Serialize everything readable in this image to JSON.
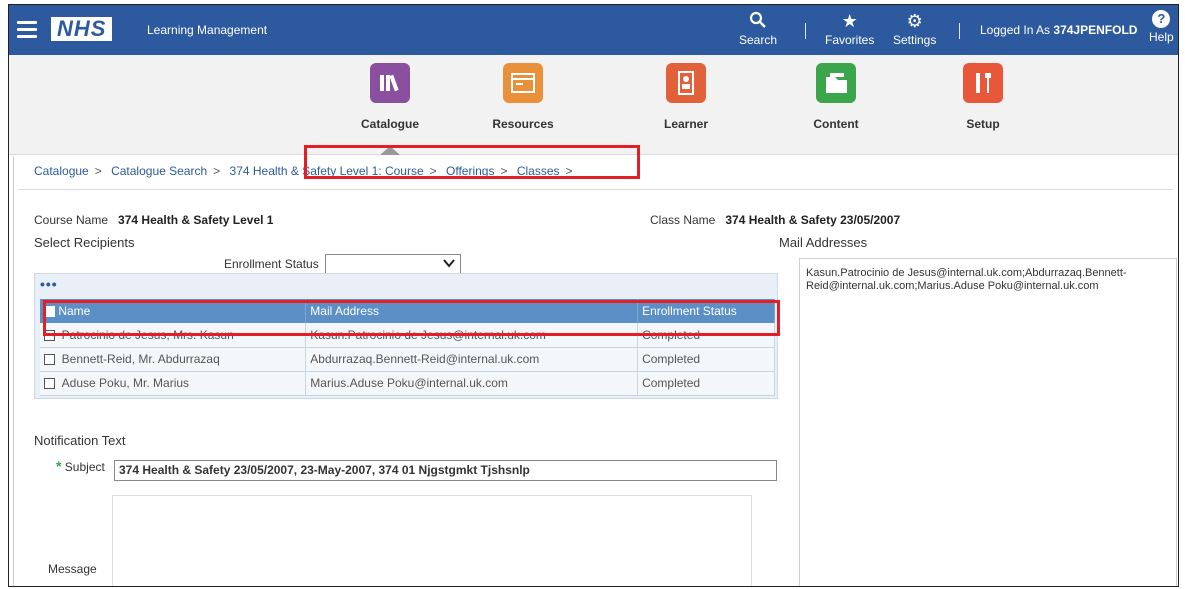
{
  "header": {
    "logo": "NHS",
    "app_title": "Learning Management",
    "search_label": "Search",
    "favorites_label": "Favorites",
    "settings_label": "Settings",
    "logged_prefix": "Logged In As",
    "logged_user": "374JPENFOLD",
    "help_label": "Help"
  },
  "nav": {
    "catalogue": "Catalogue",
    "resources": "Resources",
    "learner": "Learner",
    "content": "Content",
    "setup": "Setup"
  },
  "breadcrumb": [
    "Catalogue",
    "Catalogue Search",
    "374 Health & Safety Level 1: Course",
    "Offerings",
    "Classes"
  ],
  "course": {
    "course_name_label": "Course Name",
    "course_name": "374 Health & Safety Level 1",
    "class_name_label": "Class Name",
    "class_name": "374 Health & Safety 23/05/2007"
  },
  "recipients": {
    "title": "Select Recipients",
    "enrollment_status_label": "Enrollment Status",
    "enrollment_status_value": "",
    "more_label": "•••",
    "columns": [
      "Name",
      "Mail Address",
      "Enrollment Status"
    ],
    "rows": [
      {
        "name": "Patrocinio de Jesus, Mrs. Kasun",
        "mail": "Kasun.Patrocinio de Jesus@internal.uk.com",
        "status": "Completed"
      },
      {
        "name": "Bennett-Reid, Mr. Abdurrazaq",
        "mail": "Abdurrazaq.Bennett-Reid@internal.uk.com",
        "status": "Completed"
      },
      {
        "name": "Aduse Poku, Mr. Marius",
        "mail": "Marius.Aduse Poku@internal.uk.com",
        "status": "Completed"
      }
    ]
  },
  "mail_addresses": {
    "title": "Mail Addresses",
    "value": "Kasun.Patrocinio de Jesus@internal.uk.com;Abdurrazaq.Bennett-Reid@internal.uk.com;Marius.Aduse Poku@internal.uk.com"
  },
  "notification": {
    "title": "Notification Text",
    "required_mark": "*",
    "subject_label": "Subject",
    "subject_value": "374 Health & Safety 23/05/2007, 23-May-2007, 374 01 Njgstgmkt Tjshsnlp",
    "message_label": "Message"
  },
  "colors": {
    "header_bg": "#2d5a9e",
    "table_header": "#5b8fc6",
    "highlight": "#e31e24"
  }
}
